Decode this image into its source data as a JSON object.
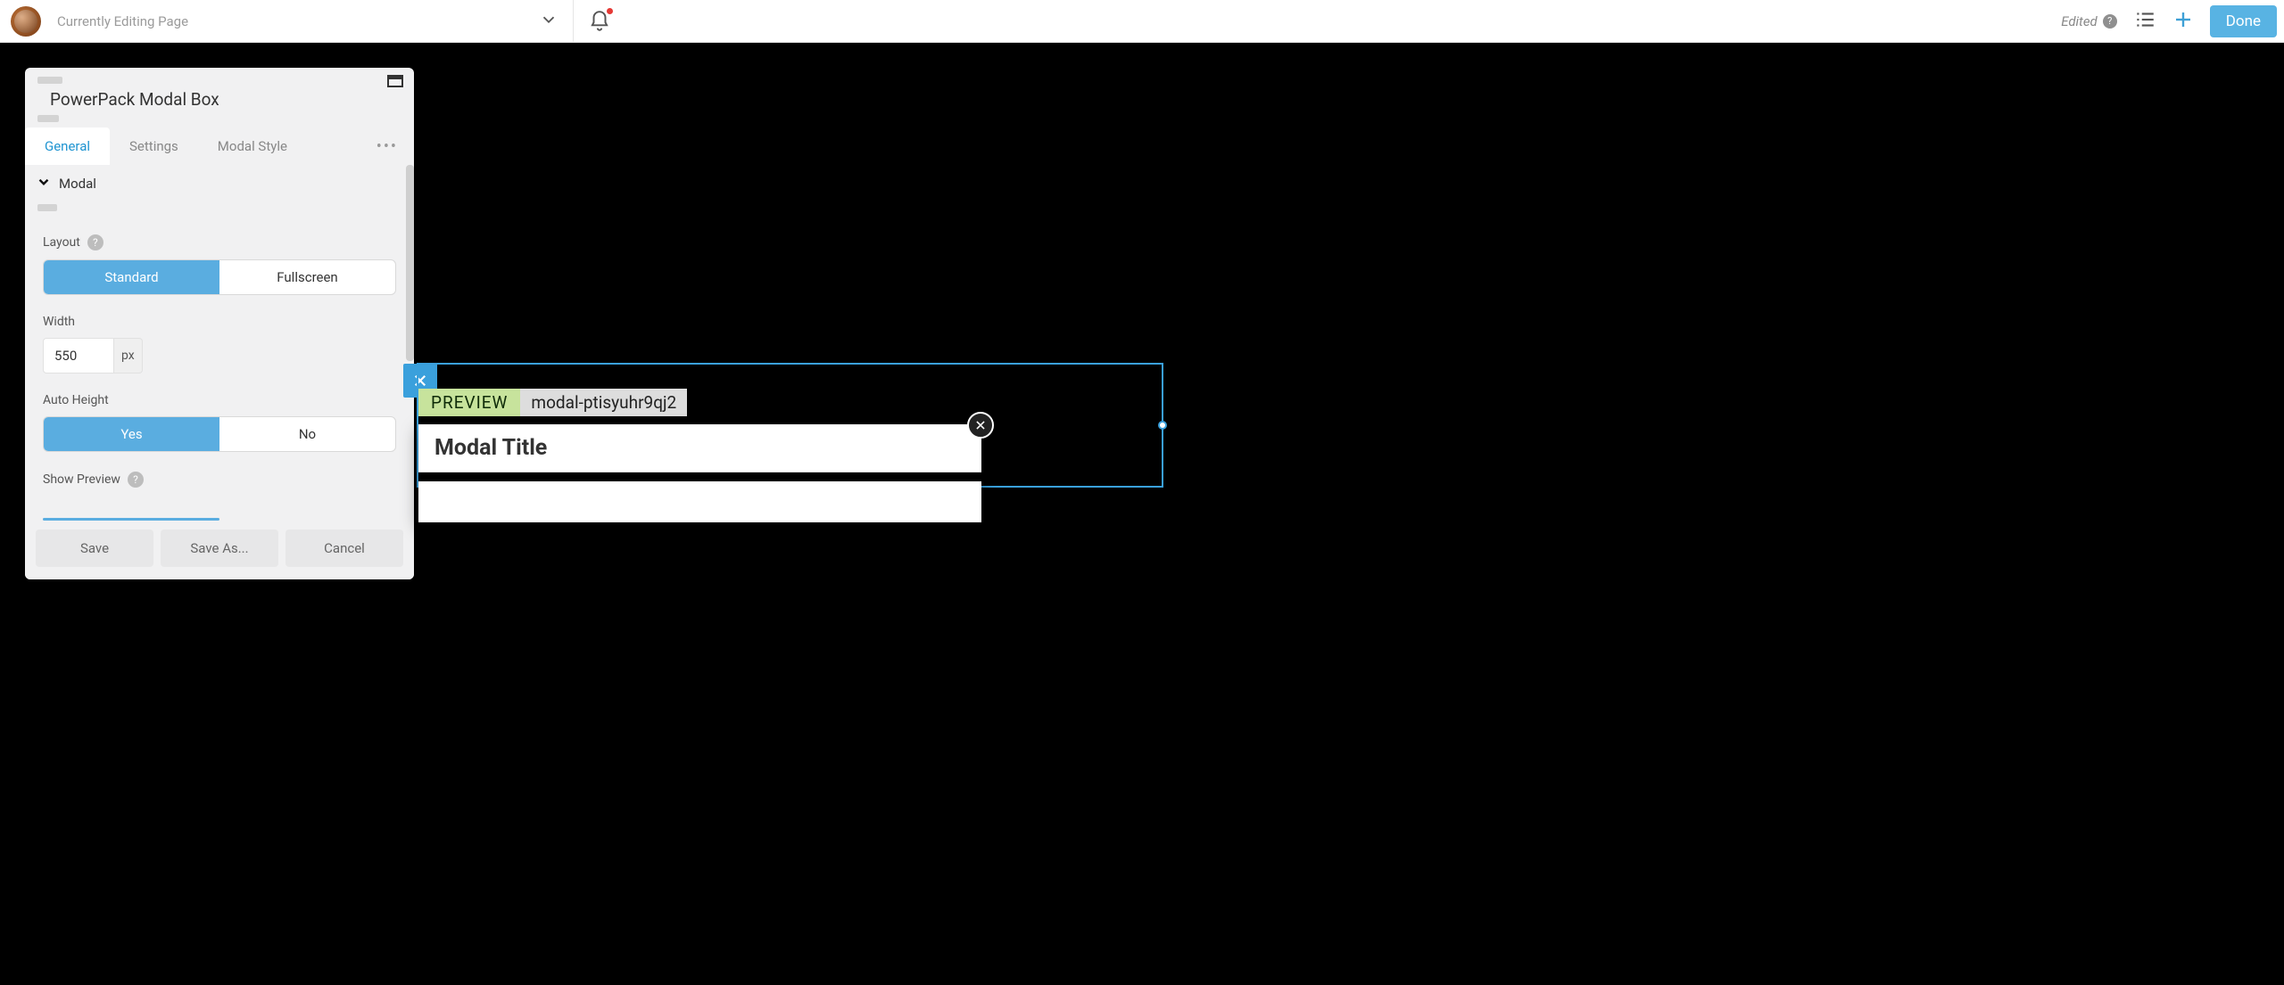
{
  "topbar": {
    "page_title": "Currently Editing Page",
    "edited_label": "Edited",
    "done_label": "Done"
  },
  "panel": {
    "title": "PowerPack Modal Box",
    "tabs": {
      "general": "General",
      "settings": "Settings",
      "modal_style": "Modal Style"
    },
    "section_modal": "Modal",
    "layout_label": "Layout",
    "layout_options": {
      "standard": "Standard",
      "fullscreen": "Fullscreen"
    },
    "width_label": "Width",
    "width_value": "550",
    "width_unit": "px",
    "auto_height_label": "Auto Height",
    "yes": "Yes",
    "no": "No",
    "show_preview_label": "Show Preview",
    "footer": {
      "save": "Save",
      "save_as": "Save As...",
      "cancel": "Cancel"
    }
  },
  "preview": {
    "badge": "PREVIEW",
    "modal_id": "modal-ptisyuhr9qj2",
    "modal_title": "Modal Title"
  }
}
